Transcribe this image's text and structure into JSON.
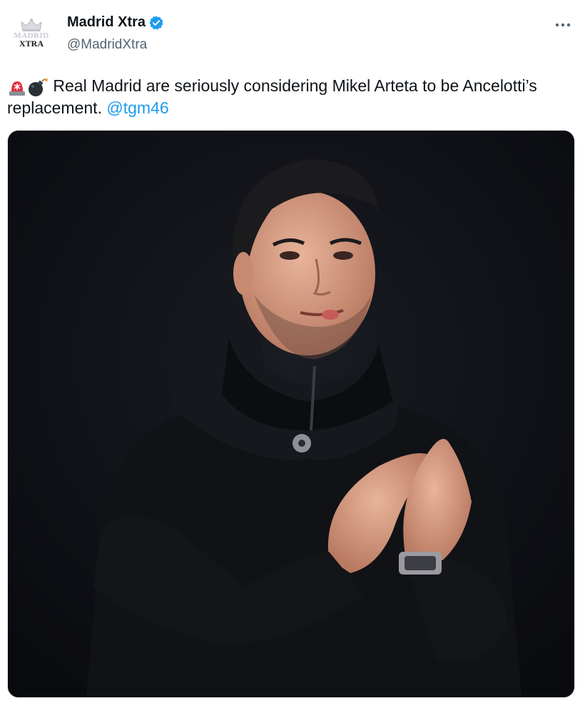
{
  "account": {
    "display_name": "Madrid Xtra",
    "handle": "@MadridXtra",
    "verified": true,
    "avatar_logo_top": "MADRID",
    "avatar_logo_bottom": "XTRA",
    "avatar_icon": "crown-icon"
  },
  "menu": {
    "icon": "more-options-icon"
  },
  "tweet": {
    "emoji_1": "police-light-icon",
    "emoji_2": "bomb-icon",
    "text_before": " Real Madrid are seriously considering Mikel Arteta to be Ancelotti’s replacement. ",
    "mention": "@tgm46"
  },
  "media": {
    "type": "photo",
    "subject": "man in black hooded coat clapping"
  },
  "colors": {
    "text": "#0f1419",
    "secondary": "#536471",
    "link": "#1d9bf0",
    "verified": "#1d9bf0"
  }
}
